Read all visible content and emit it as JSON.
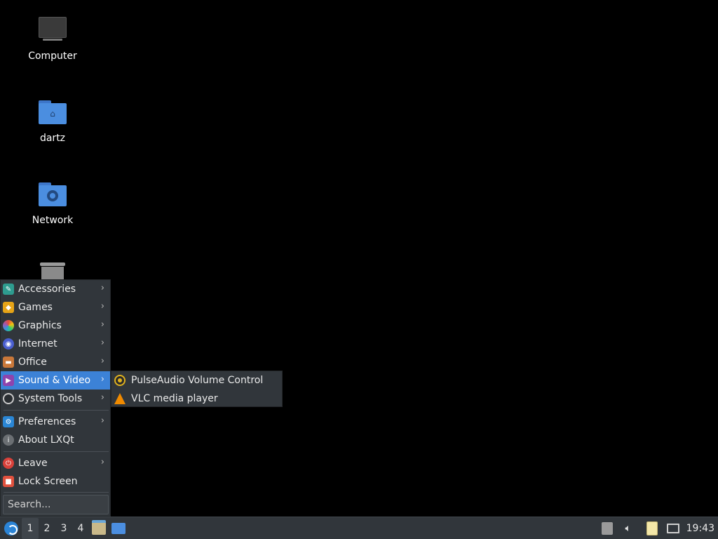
{
  "desktop": {
    "icons": [
      {
        "label": "Computer",
        "icon": "computer-icon"
      },
      {
        "label": "dartz",
        "icon": "home-folder-icon"
      },
      {
        "label": "Network",
        "icon": "network-folder-icon"
      },
      {
        "label": "",
        "icon": "trash-icon"
      }
    ]
  },
  "main_menu": {
    "items": [
      {
        "label": "Accessories",
        "icon": "accessories-icon",
        "submenu": true
      },
      {
        "label": "Games",
        "icon": "games-icon",
        "submenu": true
      },
      {
        "label": "Graphics",
        "icon": "graphics-icon",
        "submenu": true
      },
      {
        "label": "Internet",
        "icon": "internet-icon",
        "submenu": true
      },
      {
        "label": "Office",
        "icon": "office-icon",
        "submenu": true
      },
      {
        "label": "Sound & Video",
        "icon": "sound-video-icon",
        "submenu": true,
        "active": true
      },
      {
        "label": "System Tools",
        "icon": "system-tools-icon",
        "submenu": true
      },
      {
        "label": "Preferences",
        "icon": "preferences-icon",
        "submenu": true
      },
      {
        "label": "About LXQt",
        "icon": "info-icon",
        "submenu": false
      },
      {
        "label": "Leave",
        "icon": "power-icon",
        "submenu": true
      },
      {
        "label": "Lock Screen",
        "icon": "lock-icon",
        "submenu": false
      }
    ],
    "search_placeholder": "Search...",
    "arrow_glyph": "›"
  },
  "submenu": {
    "items": [
      {
        "label": "PulseAudio Volume Control",
        "icon": "pulseaudio-icon"
      },
      {
        "label": "VLC media player",
        "icon": "vlc-icon"
      }
    ]
  },
  "taskbar": {
    "workspaces": [
      "1",
      "2",
      "3",
      "4"
    ],
    "active_workspace": "1",
    "clock": "19:43",
    "quicklaunch": [
      "file-manager-icon",
      "show-desktop-icon"
    ],
    "tray": [
      "removable-media-icon",
      "volume-icon",
      "clipboard-icon",
      "network-icon"
    ]
  },
  "colors": {
    "panel_bg": "#31363b",
    "highlight": "#3c82d7",
    "desktop_bg": "#000000"
  }
}
